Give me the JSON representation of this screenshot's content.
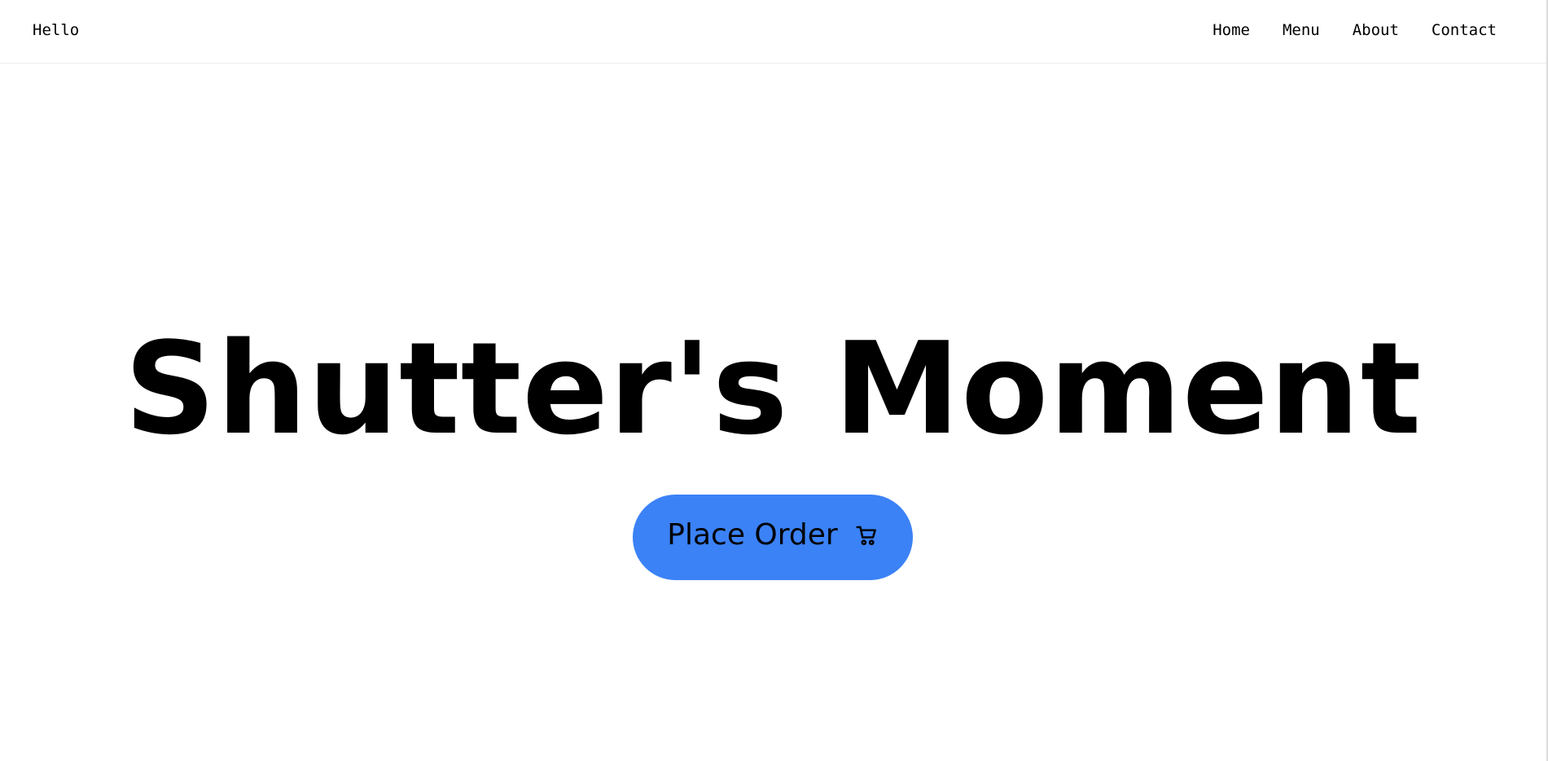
{
  "nav": {
    "brand": "Hello",
    "links": [
      "Home",
      "Menu",
      "About",
      "Contact"
    ]
  },
  "hero": {
    "title": "Shutter's Moment",
    "cta_label": "Place Order",
    "cta_icon": "cart-icon"
  },
  "colors": {
    "accent": "#3b82f6",
    "text": "#000000",
    "background": "#ffffff"
  }
}
